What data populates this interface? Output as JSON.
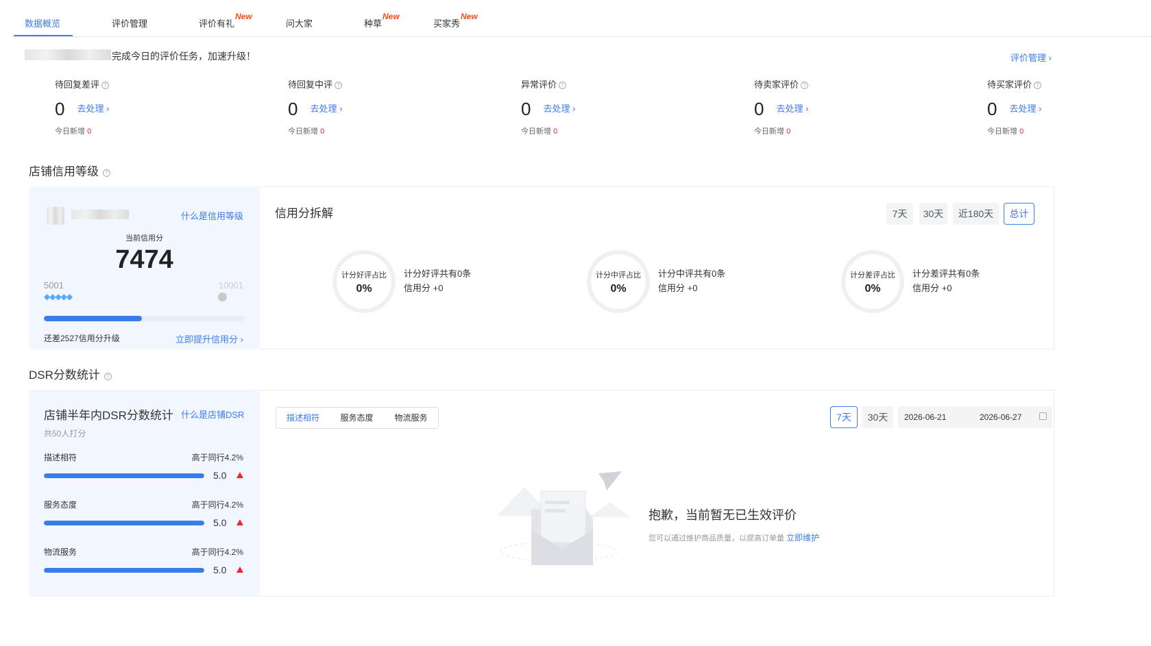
{
  "tabs": [
    {
      "label": "数据概览",
      "active": true
    },
    {
      "label": "评价管理"
    },
    {
      "label": "评价有礼",
      "badge": "New"
    },
    {
      "label": "问大家"
    },
    {
      "label": "种草",
      "badge": "New"
    },
    {
      "label": "买家秀",
      "badge": "New"
    }
  ],
  "banner": {
    "message": "完成今日的评价任务，加速升级！",
    "link": "评价管理 ›"
  },
  "metrics": [
    {
      "label": "待回复差评",
      "value": "0",
      "action": "去处理 ›",
      "sub_label": "今日新增",
      "sub_value": "0"
    },
    {
      "label": "待回复中评",
      "value": "0",
      "action": "去处理 ›",
      "sub_label": "今日新增",
      "sub_value": "0"
    },
    {
      "label": "异常评价",
      "value": "0",
      "action": "去处理 ›",
      "sub_label": "今日新增",
      "sub_value": "0"
    },
    {
      "label": "待卖家评价",
      "value": "0",
      "action": "去处理 ›",
      "sub_label": "今日新增",
      "sub_value": "0"
    },
    {
      "label": "待买家评价",
      "value": "0",
      "action": "去处理 ›",
      "sub_label": "今日新增",
      "sub_value": "0"
    }
  ],
  "credit": {
    "section_title": "店铺信用等级",
    "what_link": "什么是信用等级",
    "current_label": "当前信用分",
    "score": "7474",
    "range_min": "5001",
    "range_max": "10001",
    "progress": 0.49,
    "gap_text": "还差2527信用分升级",
    "upgrade_link": "立即提升信用分 ›",
    "breakdown_title": "信用分拆解",
    "periods": [
      "7天",
      "30天",
      "近180天",
      "总计"
    ],
    "active_period": "总计",
    "rings": [
      {
        "label": "计分好评占比",
        "value": "0%",
        "line1": "计分好评共有0条",
        "line2": "信用分 +0"
      },
      {
        "label": "计分中评占比",
        "value": "0%",
        "line1": "计分中评共有0条",
        "line2": "信用分 +0"
      },
      {
        "label": "计分差评占比",
        "value": "0%",
        "line1": "计分差评共有0条",
        "line2": "信用分 +0"
      }
    ]
  },
  "dsr": {
    "section_title": "DSR分数统计",
    "panel_title": "店铺半年内DSR分数统计",
    "what_link": "什么是店铺DSR",
    "raters": "共50人打分",
    "items": [
      {
        "label": "描述相符",
        "compare": "高于同行4.2%",
        "score": "5.0",
        "fill": 1.0
      },
      {
        "label": "服务态度",
        "compare": "高于同行4.2%",
        "score": "5.0",
        "fill": 1.0
      },
      {
        "label": "物流服务",
        "compare": "高于同行4.2%",
        "score": "5.0",
        "fill": 1.0
      }
    ],
    "segments": [
      "描述相符",
      "服务态度",
      "物流服务"
    ],
    "active_segment": "描述相符",
    "periods": [
      "7天",
      "30天"
    ],
    "active_period": "7天",
    "date_start": "2026-06-21",
    "date_end": "2026-06-27",
    "empty_title": "抱歉，当前暂无已生效评价",
    "empty_desc": "您可以通过维护商品质量，以提高订单量",
    "empty_link": "立即维护"
  },
  "colors": {
    "accent": "#3b7ced",
    "new_badge": "#ff4a1a",
    "alert": "#f5222d",
    "panel_bg": "#f2f7ff"
  }
}
